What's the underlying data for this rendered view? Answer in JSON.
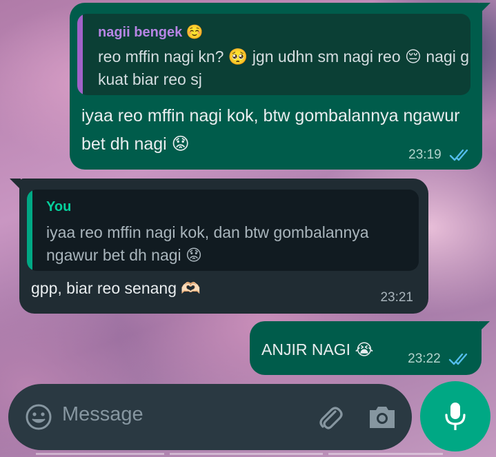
{
  "messages": [
    {
      "direction": "outgoing",
      "quote": {
        "author": "nagii bengek ☺️",
        "text": "reo mffin nagi kn? 🥺 jgn udhn sm nagi reo 😔 nagi g kuat biar reo sj"
      },
      "text": "iyaa reo mffin nagi kok, btw gombalannya ngawur bet dh nagi 😟",
      "time": "23:19",
      "status": "read"
    },
    {
      "direction": "incoming",
      "quote": {
        "author": "You",
        "text": "iyaa reo mffin nagi kok, dan btw gombalannya ngawur bet dh nagi 😟"
      },
      "text": "gpp, biar reo senang 🫶🏻",
      "time": "23:21"
    },
    {
      "direction": "outgoing",
      "text": "ANJIR NAGI 😭",
      "time": "23:22",
      "status": "read"
    }
  ],
  "input": {
    "placeholder": "Message"
  },
  "icons": {
    "emoji": "emoji-icon",
    "attach": "paperclip-icon",
    "camera": "camera-icon",
    "mic": "mic-icon",
    "read": "double-check-icon"
  },
  "colors": {
    "outgoing_bubble": "#005c4b",
    "incoming_bubble": "#202c33",
    "read_ticks": "#53bdeb",
    "accent": "#00a884"
  }
}
